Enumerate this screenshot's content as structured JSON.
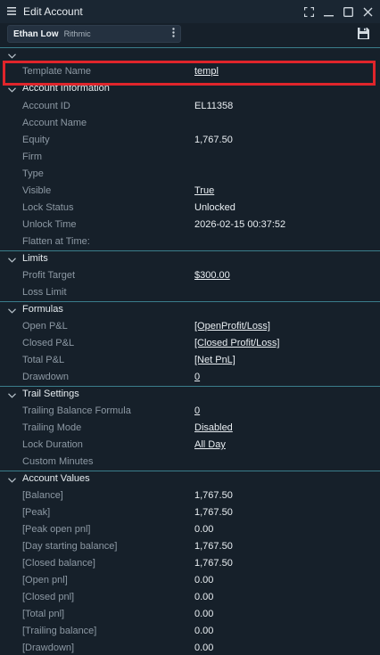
{
  "window": {
    "title": "Edit Account"
  },
  "account": {
    "name": "Ethan Low",
    "provider": "Rithmic"
  },
  "template": {
    "label": "Template Name",
    "value": "templ"
  },
  "sections": [
    {
      "title": "Account Information",
      "rows": [
        {
          "label": "Account ID",
          "value": "EL11358",
          "link": false
        },
        {
          "label": "Account Name",
          "value": "",
          "link": false
        },
        {
          "label": "Equity",
          "value": "1,767.50",
          "link": false
        },
        {
          "label": "Firm",
          "value": "",
          "link": false
        },
        {
          "label": "Type",
          "value": "",
          "link": false
        },
        {
          "label": "Visible",
          "value": "True",
          "link": true
        },
        {
          "label": "Lock Status",
          "value": "Unlocked",
          "link": false
        },
        {
          "label": "Unlock Time",
          "value": "2026-02-15 00:37:52",
          "link": false
        },
        {
          "label": "Flatten at Time:",
          "value": "",
          "link": false
        }
      ]
    },
    {
      "title": "Limits",
      "rows": [
        {
          "label": "Profit Target",
          "value": "$300.00",
          "link": true
        },
        {
          "label": "Loss Limit",
          "value": "",
          "link": false
        }
      ]
    },
    {
      "title": "Formulas",
      "rows": [
        {
          "label": "Open P&L",
          "value": "[OpenProfit/Loss]",
          "link": true
        },
        {
          "label": "Closed P&L",
          "value": "[Closed Profit/Loss]",
          "link": true
        },
        {
          "label": "Total P&L",
          "value": "[Net PnL]",
          "link": true
        },
        {
          "label": "Drawdown",
          "value": "0",
          "link": true
        }
      ]
    },
    {
      "title": "Trail Settings",
      "rows": [
        {
          "label": "Trailing Balance Formula",
          "value": "0",
          "link": true
        },
        {
          "label": "Trailing Mode",
          "value": "Disabled",
          "link": true
        },
        {
          "label": "Lock Duration",
          "value": "All Day",
          "link": true
        },
        {
          "label": "Custom Minutes",
          "value": "",
          "link": false
        }
      ]
    },
    {
      "title": "Account Values",
      "rows": [
        {
          "label": "[Balance]",
          "value": "1,767.50",
          "link": false
        },
        {
          "label": "[Peak]",
          "value": "1,767.50",
          "link": false
        },
        {
          "label": "[Peak open pnl]",
          "value": "0.00",
          "link": false
        },
        {
          "label": "[Day starting balance]",
          "value": "1,767.50",
          "link": false
        },
        {
          "label": "[Closed balance]",
          "value": "1,767.50",
          "link": false
        },
        {
          "label": "[Open pnl]",
          "value": "0.00",
          "link": false
        },
        {
          "label": "[Closed pnl]",
          "value": "0.00",
          "link": false
        },
        {
          "label": "[Total pnl]",
          "value": "0.00",
          "link": false
        },
        {
          "label": "[Trailing balance]",
          "value": "0.00",
          "link": false
        },
        {
          "label": "[Drawdown]",
          "value": "0.00",
          "link": false
        }
      ]
    }
  ],
  "colors": {
    "background": "#16202a",
    "divider": "#3a7d8b",
    "highlight": "#e0252b"
  },
  "icons": [
    "menu-icon",
    "expand-icon",
    "minimize-icon",
    "maximize-icon",
    "close-icon",
    "save-icon",
    "kebab-icon",
    "chevron-down-icon"
  ]
}
